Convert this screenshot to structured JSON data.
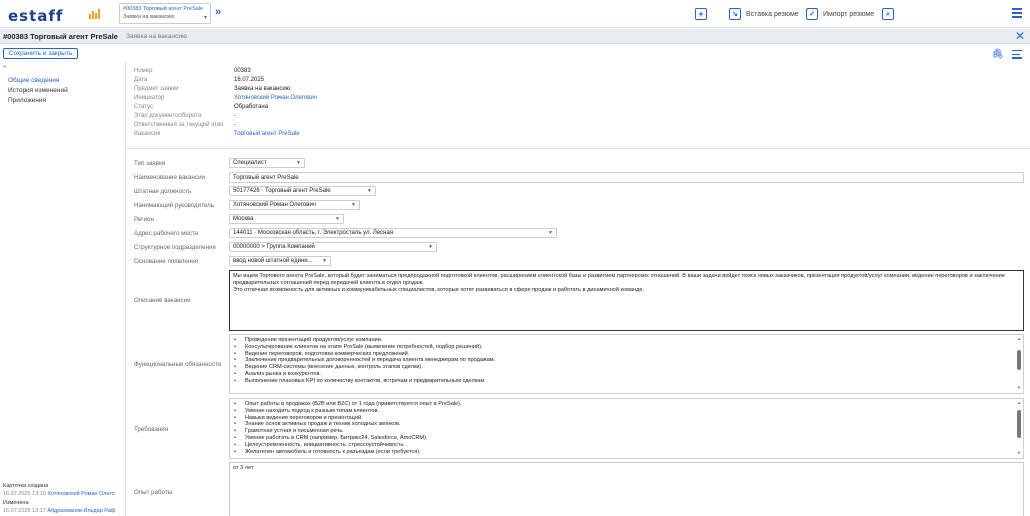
{
  "app": {
    "logo_text": "estaff",
    "tab": {
      "line1": "#00383 Торговый агент PreSale",
      "line2": "Заявка на вакансию"
    },
    "toolbar": {
      "add_icon": "plus-square-icon",
      "insert_resume": "Вставка резюме",
      "import_resume": "Импорт резюме",
      "accent": "#2a62c9",
      "brand_bars": "#f0a020"
    }
  },
  "header": {
    "title": "#00383 Торговый агент PreSale",
    "subtitle": "Заявка на вакансию"
  },
  "actions": {
    "save_close": "Сохранить и закрыть"
  },
  "sidebar": {
    "collapse": "«",
    "items": [
      {
        "label": "Общие сведения"
      },
      {
        "label": "История изменений"
      },
      {
        "label": "Приложения"
      }
    ],
    "footer": {
      "created_label": "Карточка создана",
      "created_date": "16.07.2025  13:10",
      "created_by": "Хотяновский Роман Олего",
      "changed_label": "Изменена",
      "changed_date": "16.07.2025  13:17",
      "changed_by": "Абдрахманов Ильдар Раф"
    }
  },
  "info": [
    {
      "key": "Номер",
      "value": "00383"
    },
    {
      "key": "Дата",
      "value": "16.07.2025"
    },
    {
      "key": "Предмет заявки",
      "value": "Заявка на вакансию"
    },
    {
      "key": "Инициатор",
      "value": "Хотяновский Роман Олегович"
    },
    {
      "key": "Статус",
      "value": "Обработана"
    },
    {
      "key": "Этап документооборота",
      "value": "-"
    },
    {
      "key": "Ответственный за текущий этап",
      "value": "-"
    },
    {
      "key": "Вакансия",
      "value": "Торговый агент PreSale"
    }
  ],
  "form": {
    "request_type": {
      "label": "Тип заявки",
      "value": "Специалист"
    },
    "vacancy_name": {
      "label": "Наименование вакансии",
      "value": "Торговый агент PreSale"
    },
    "position": {
      "label": "Штатная должность",
      "value": "50177426 · Торговый агент PreSale"
    },
    "manager": {
      "label": "Нанимающий руководитель",
      "value": "Хотяновский Роман Олегович"
    },
    "region": {
      "label": "Регион",
      "value": "Москва"
    },
    "address": {
      "label": "Адрес рабочего места",
      "value": "144011 · Московская область, г. Электросталь ул. Лесная"
    },
    "division": {
      "label": "Структурное подразделение",
      "value": "00000000 > Группа Компаний"
    },
    "reason": {
      "label": "Основание появления",
      "value": "ввод новой штатной едини..."
    },
    "description": {
      "label": "Описание вакансии",
      "text1": "Мы ищем Торгового агента PreSale, который будет заниматься предпродажной подготовкой клиентов, расширением клиентской базы и развитием партнерских отношений. В ваши задачи войдет поиск новых заказчиков, презентация продуктов/услуг компании, ведение переговоров и заключение предварительных соглашений перед передачей клиента в отдел продаж.",
      "text2": "Это отличная возможность для активных и коммуникабельных специалистов, которые хотят развиваться в сфере продаж и работать в динамичной команде."
    },
    "duties": {
      "label": "Функциональные обязанности",
      "items": [
        "Проведение презентаций продуктов/услуг компании.",
        "Консультирование клиентов на этапе PreSale (выявление потребностей, подбор решений).",
        "Ведение переговоров, подготовка коммерческих предложений.",
        "Заключение предварительных договоренностей и передача клиента менеджерам по продажам.",
        "Ведение CRM-системы (внесение данных, контроль этапов сделки).",
        "Анализ рынка и конкурентов.",
        "Выполнение плановых KPI по количеству контактов, встречам и предварительным сделкам."
      ]
    },
    "requirements": {
      "label": "Требования",
      "items": [
        "Опыт работы в продажах (B2B или B2C) от 1 года (приветствуется опыт в PreSale).",
        "Умение находить подход к разным типам клиентов.",
        "Навыки ведения переговоров и презентаций.",
        "Знание основ активных продаж и техник холодных звонков.",
        "Грамотная устная и письменная речь.",
        "Умение работать в CRM (например, Битрикс24, Salesforce, AmoCRM).",
        "Целеустремленность, инициативность, стрессоустойчивость.",
        "Желателен автомобиль и готовность к разъездам (если требуется)."
      ]
    },
    "experience": {
      "label": "Опыт работы",
      "value": "от 3 лет"
    }
  }
}
